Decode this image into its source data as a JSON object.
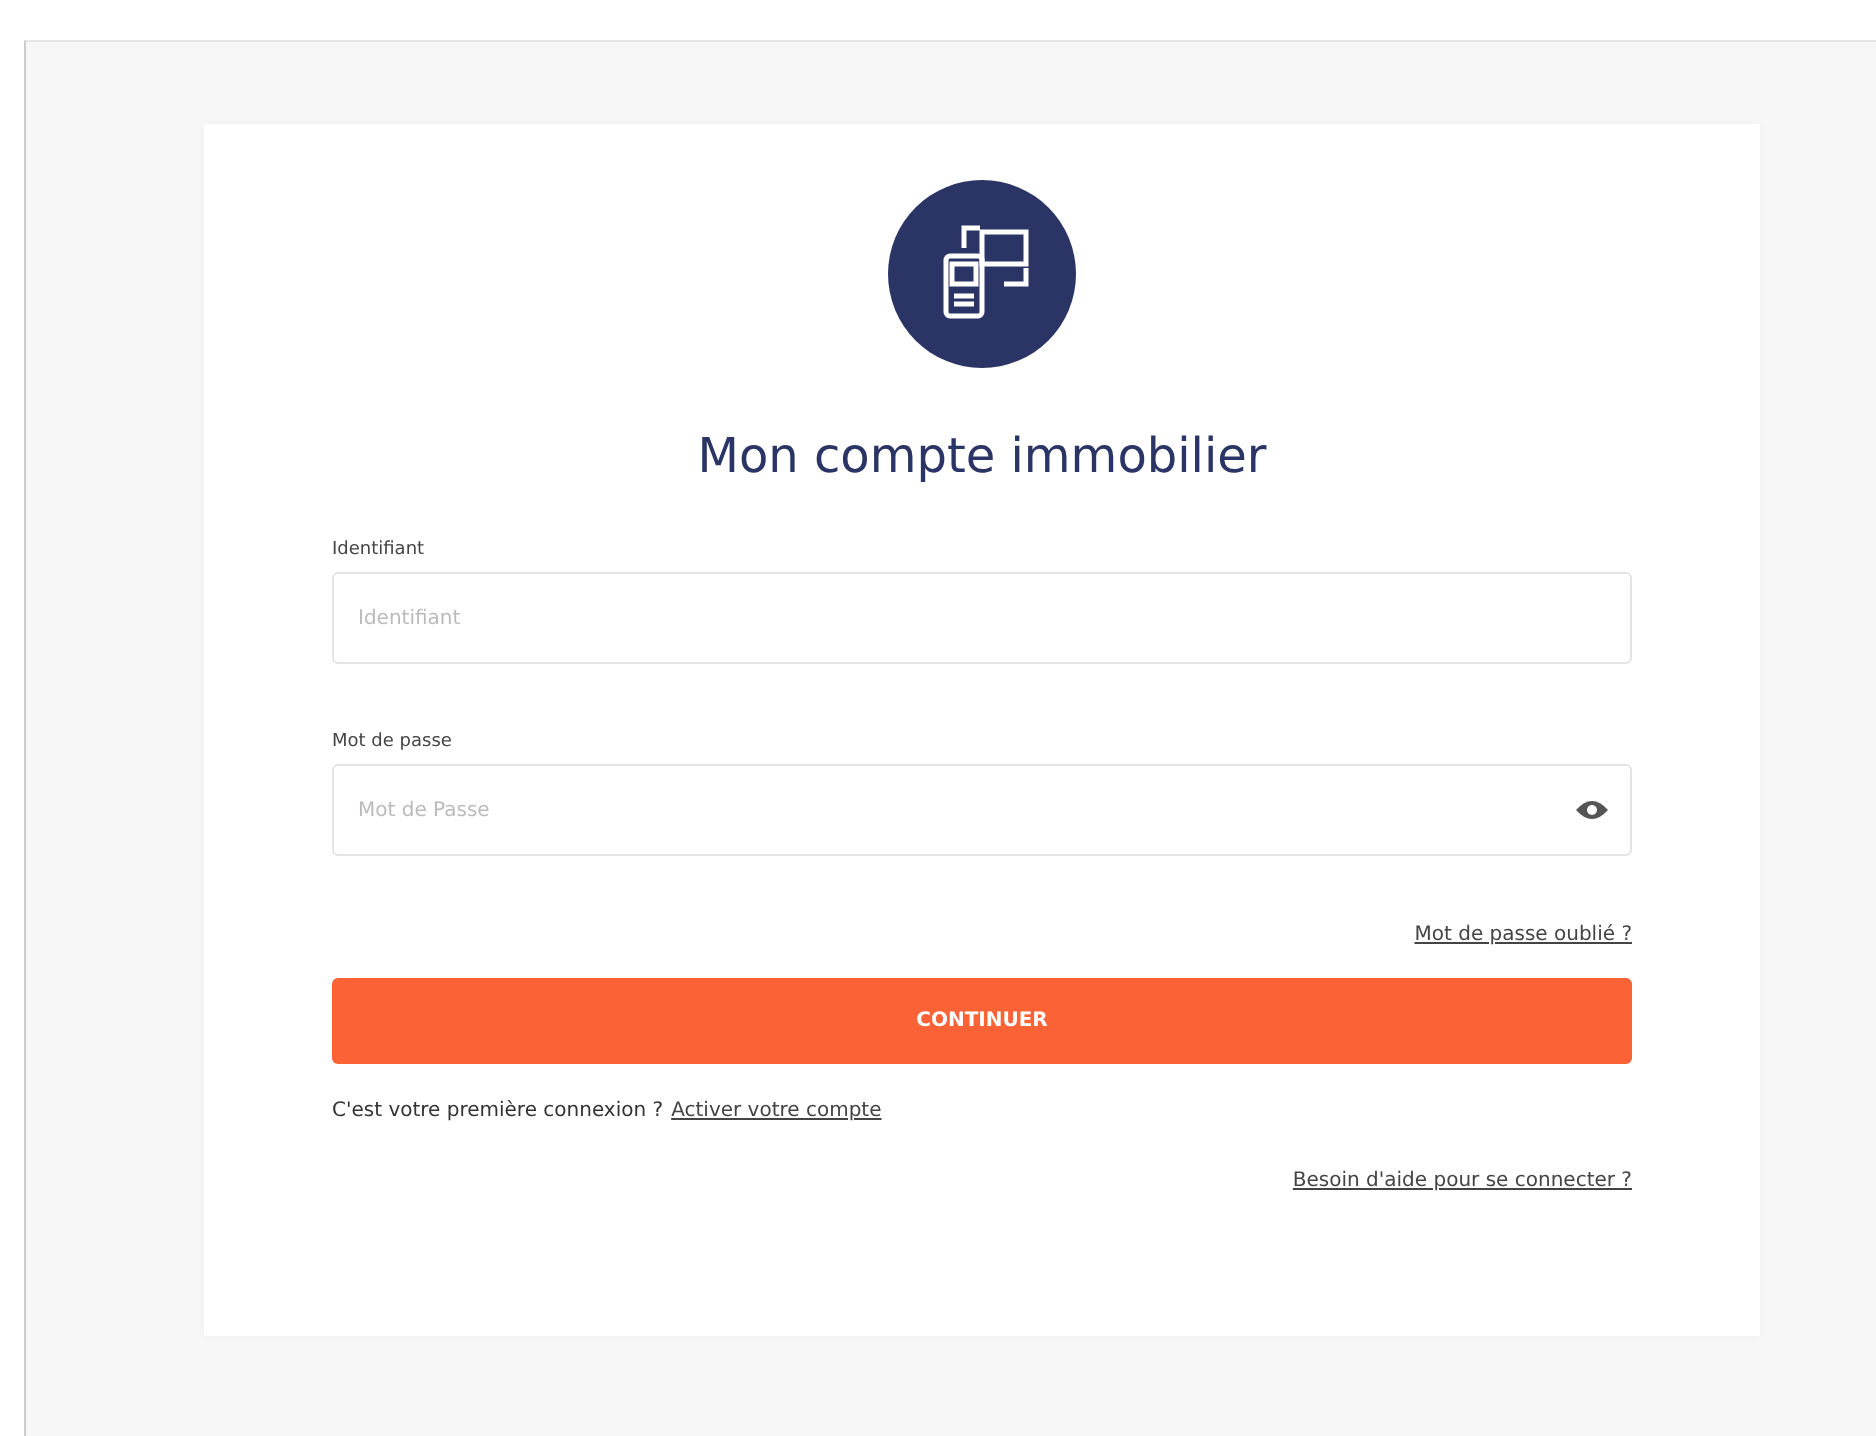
{
  "title": "Mon compte immobilier",
  "fields": [
    {
      "label": "Identifiant",
      "placeholder": "Identifiant",
      "kind": "text"
    },
    {
      "label": "Mot de passe",
      "placeholder": "Mot de Passe",
      "kind": "password"
    }
  ],
  "forgot_link": "Mot de passe oublié ?",
  "submit_button": "CONTINUER",
  "first_connection": {
    "text": "C'est votre première connexion ?",
    "link": "Activer votre compte"
  },
  "help_link": "Besoin d'aide pour se connecter ?"
}
